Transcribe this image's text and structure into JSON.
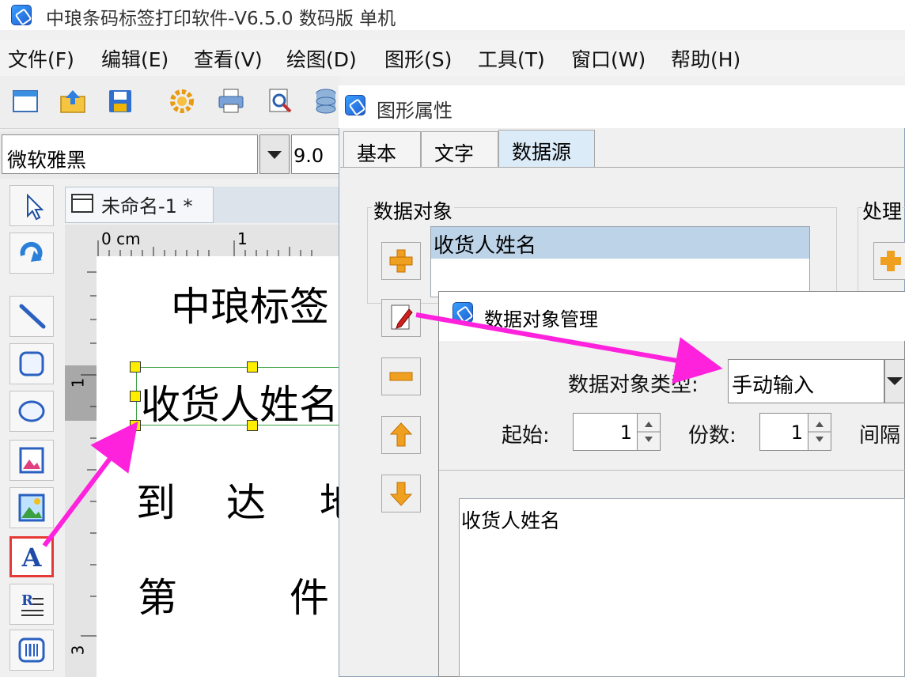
{
  "app": {
    "title": "中琅条码标签打印软件-V6.5.0 数码版 单机"
  },
  "menu": [
    "文件(F)",
    "编辑(E)",
    "查看(V)",
    "绘图(D)",
    "图形(S)",
    "工具(T)",
    "窗口(W)",
    "帮助(H)"
  ],
  "font": {
    "name": "微软雅黑",
    "size": "9.0"
  },
  "document": {
    "tab_title": "未命名-1 *"
  },
  "ruler": {
    "h_unit": "0 cm",
    "h_mark1": "1",
    "v_mark1": "1",
    "v_mark3": "3"
  },
  "label": {
    "line1": "中琅标签",
    "line2": "收货人姓名",
    "line3_a": "到",
    "line3_b": "达",
    "line3_c": "地",
    "line4_a": "第",
    "line4_b": "件"
  },
  "prop_dialog": {
    "title": "图形属性",
    "tabs": [
      "基本",
      "文字",
      "数据源"
    ],
    "active_tab": "数据源",
    "group_data_object": "数据对象",
    "group_process": "处理",
    "list_item": "收货人姓名"
  },
  "data_dialog": {
    "title": "数据对象管理",
    "type_label": "数据对象类型:",
    "type_value": "手动输入",
    "start_label": "起始:",
    "start_value": "1",
    "copies_label": "份数:",
    "copies_value": "1",
    "interval_label": "间隔",
    "content": "收货人姓名"
  },
  "colors": {
    "annotation_arrow": "#ff22dd",
    "highlight_box": "#e53935",
    "selection_handle": "#ffee00"
  }
}
